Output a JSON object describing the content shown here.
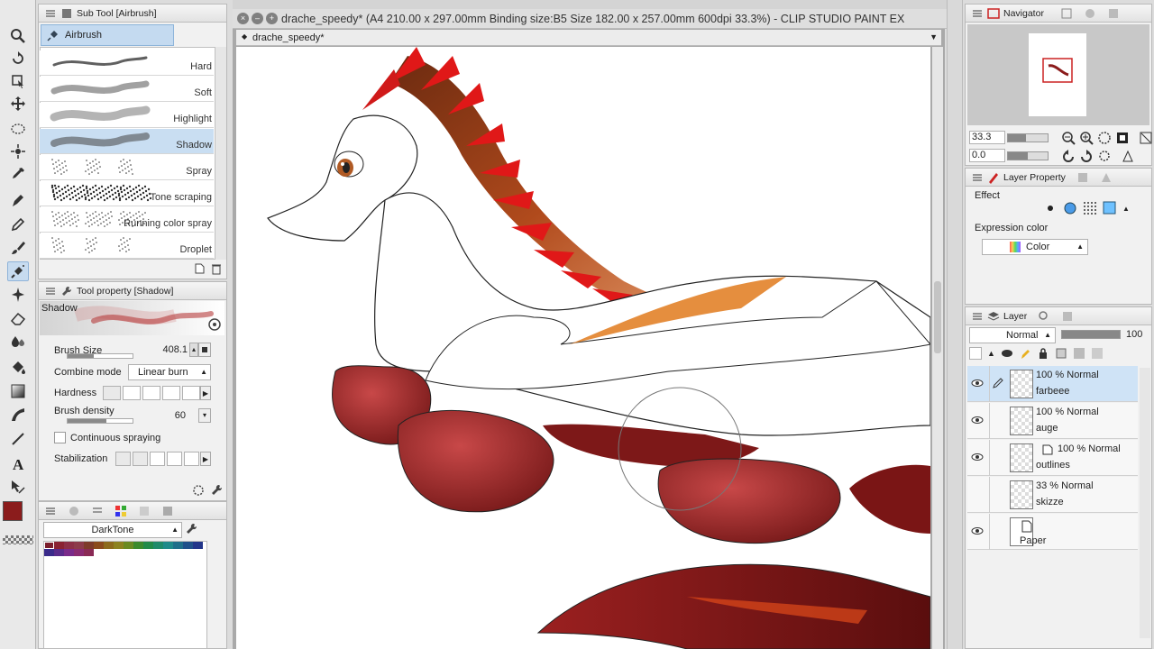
{
  "window": {
    "title": "drache_speedy* (A4 210.00 x 297.00mm Binding size:B5 Size 182.00 x 257.00mm 600dpi 33.3%) - CLIP STUDIO PAINT EX",
    "doc_tab": "drache_speedy*"
  },
  "subtool": {
    "title": "Sub Tool [Airbrush]",
    "group": "Airbrush",
    "brushes": [
      "Hard",
      "Soft",
      "Highlight",
      "Shadow",
      "Spray",
      "Tone scraping",
      "Running color spray",
      "Droplet"
    ],
    "active": "Shadow"
  },
  "tool_property": {
    "title": "Tool property [Shadow]",
    "preview_label": "Shadow",
    "brush_size_label": "Brush Size",
    "brush_size_value": "408.1",
    "combine_mode_label": "Combine mode",
    "combine_mode_value": "Linear burn",
    "hardness_label": "Hardness",
    "brush_density_label": "Brush density",
    "brush_density_value": "60",
    "continuous_spraying_label": "Continuous spraying",
    "stabilization_label": "Stabilization"
  },
  "color_set": {
    "name": "DarkTone",
    "colors": [
      "#7b1e2c",
      "#8a2232",
      "#8c2f46",
      "#8c3a4a",
      "#7d3a2a",
      "#8a4a1c",
      "#8c6a1c",
      "#8c8220",
      "#6a8a22",
      "#3c8a2c",
      "#228a48",
      "#1f8a6a",
      "#1f8a8a",
      "#1f6f8a",
      "#1f508a",
      "#22358a",
      "#3a2a8a",
      "#5a2a8a",
      "#7a2a8a",
      "#8a2a72",
      "#8a2a55"
    ]
  },
  "main_color": "#8b1c1c",
  "navigator": {
    "title": "Navigator",
    "zoom": "33.3",
    "rotate": "0.0"
  },
  "layer_property": {
    "title": "Layer Property",
    "effect_label": "Effect",
    "expression_color_label": "Expression color",
    "expression_color_value": "Color"
  },
  "layers": {
    "title": "Layer",
    "blend_mode": "Normal",
    "opacity": "100",
    "items": [
      {
        "line1": "100 % Normal",
        "line2": "farbeee",
        "visible": true,
        "active": true
      },
      {
        "line1": "100 % Normal",
        "line2": "auge",
        "visible": true,
        "active": false
      },
      {
        "line1": "100 % Normal",
        "line2": "outlines",
        "visible": true,
        "active": false
      },
      {
        "line1": "33 % Normal",
        "line2": "skizze",
        "visible": false,
        "active": false
      },
      {
        "line1": "",
        "line2": "Paper",
        "visible": true,
        "active": false
      }
    ]
  }
}
